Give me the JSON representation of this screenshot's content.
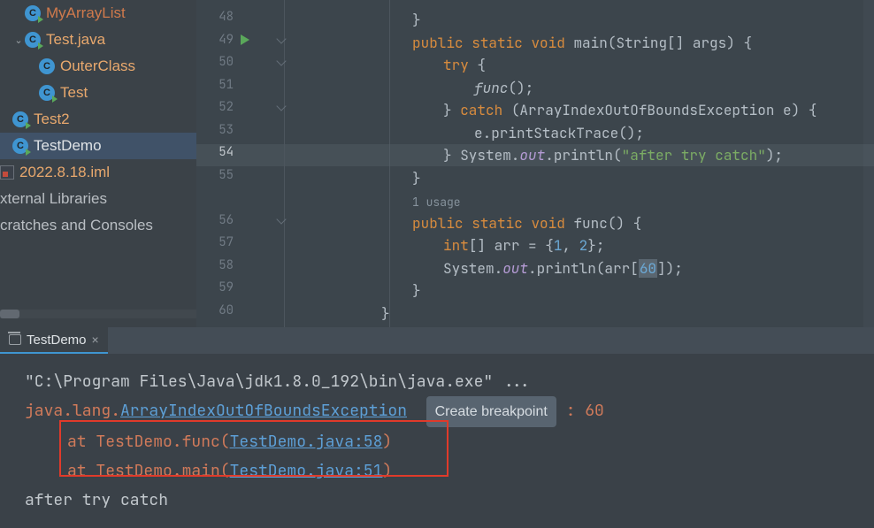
{
  "tree": {
    "items": [
      {
        "label": "MyArrayList",
        "indent": 28,
        "chev": "",
        "icon": "class-run",
        "cls": "root"
      },
      {
        "label": "Test.java",
        "indent": 14,
        "chev": "⌄",
        "icon": "class-run",
        "cls": ""
      },
      {
        "label": "OuterClass",
        "indent": 44,
        "chev": "",
        "icon": "class-icon",
        "cls": ""
      },
      {
        "label": "Test",
        "indent": 44,
        "chev": "",
        "icon": "class-run",
        "cls": ""
      },
      {
        "label": "Test2",
        "indent": 14,
        "chev": "",
        "icon": "class-run",
        "cls": ""
      },
      {
        "label": "TestDemo",
        "indent": 14,
        "chev": "",
        "icon": "class-run",
        "cls": "selected"
      },
      {
        "label": "2022.8.18.iml",
        "indent": 0,
        "chev": "",
        "icon": "iml",
        "cls": ""
      },
      {
        "label": "xternal Libraries",
        "indent": 0,
        "chev": "",
        "icon": "",
        "cls": "dim"
      },
      {
        "label": "cratches and Consoles",
        "indent": 0,
        "chev": "",
        "icon": "",
        "cls": "dim"
      }
    ]
  },
  "editor": {
    "line_numbers": [
      "48",
      "49",
      "50",
      "51",
      "52",
      "53",
      "54",
      "55",
      "",
      "56",
      "57",
      "58",
      "59",
      "60"
    ],
    "usage_hint": "1 usage",
    "current_line_index": 6,
    "highlighted_number": "60",
    "tokens": {
      "public": "public",
      "static": "static",
      "void": "void",
      "main": "main",
      "string_arr_args": "(String[] args) {",
      "try_open": "try {",
      "func_call": "func",
      "paren_semi": "();",
      "close_catch": "} ",
      "catch": "catch",
      "catch_type": " (ArrayIndexOutOfBoundsException e) {",
      "eprint": "e.printStackTrace();",
      "close_sys": "} System.",
      "out": "out",
      "println_open": ".println(",
      "after_str": "\"after try catch\"",
      "println_close": ");",
      "close_brace": "}",
      "func": "func",
      "func_sig": "() {",
      "int": "int",
      "arr_decl": "[] arr = {",
      "one": "1",
      "comma": ", ",
      "two": "2",
      "arr_close": "};",
      "sys": "System.",
      "println_arr_open": ".println(arr[",
      "println_arr_close": "]);"
    }
  },
  "console": {
    "tab_label": "TestDemo",
    "cmd": "\"C:\\Program Files\\Java\\jdk1.8.0_192\\bin\\java.exe\" ...",
    "exc_pkg": "java.lang.",
    "exc_name": "ArrayIndexOutOfBoundsException",
    "breakpoint_label": "Create breakpoint",
    "colon_idx": " : 60",
    "at": "at ",
    "frame1_prefix": "TestDemo.func(",
    "frame1_link": "TestDemo.java:58",
    "frame2_prefix": "TestDemo.main(",
    "frame2_link": "TestDemo.java:51",
    "paren_close": ")",
    "after": "after try catch"
  }
}
